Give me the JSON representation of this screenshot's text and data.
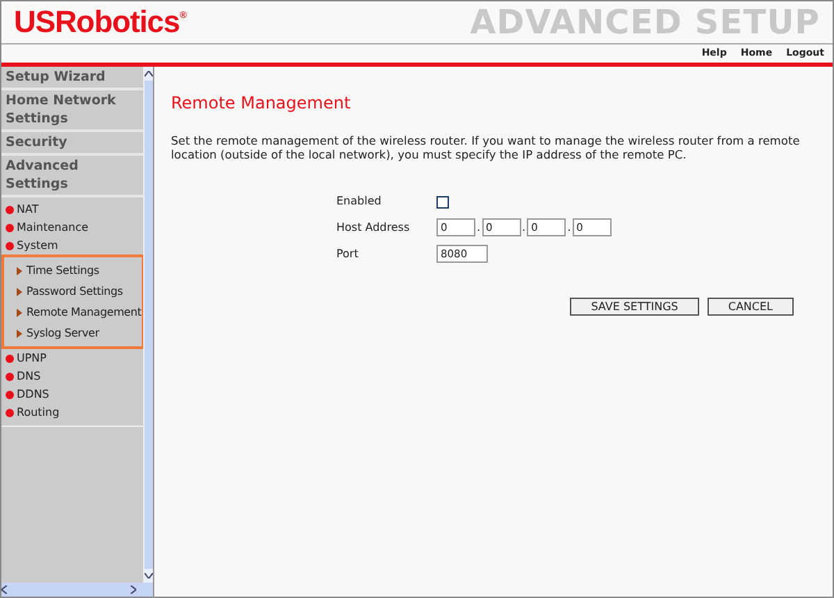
{
  "header": {
    "logo": "USRobotics",
    "logo_mark": "®",
    "title": "ADVANCED SETUP"
  },
  "top_links": [
    "Help",
    "Home",
    "Logout"
  ],
  "sidebar": {
    "sections": [
      {
        "label": "Setup Wizard"
      },
      {
        "label": "Home Network Settings"
      },
      {
        "label": "Security"
      },
      {
        "label": "Advanced Settings"
      }
    ],
    "items": [
      {
        "label": "NAT"
      },
      {
        "label": "Maintenance"
      },
      {
        "label": "System",
        "children": [
          {
            "label": "Time Settings"
          },
          {
            "label": "Password Settings"
          },
          {
            "label": "Remote Management"
          },
          {
            "label": "Syslog Server"
          }
        ]
      },
      {
        "label": "UPNP"
      },
      {
        "label": "DNS"
      },
      {
        "label": "DDNS"
      },
      {
        "label": "Routing"
      }
    ]
  },
  "page": {
    "heading": "Remote Management",
    "description": "Set the remote management of the wireless router. If you want to manage the wireless router from a remote location (outside of the local network), you must specify the IP address of the remote PC.",
    "enabled": {
      "label": "Enabled",
      "checked": false
    },
    "host_address": {
      "label": "Host Address",
      "octets": [
        "0",
        "0",
        "0",
        "0"
      ],
      "separator": "."
    },
    "port": {
      "label": "Port",
      "value": "8080"
    },
    "buttons": [
      "SAVE SETTINGS",
      "CANCEL"
    ]
  }
}
